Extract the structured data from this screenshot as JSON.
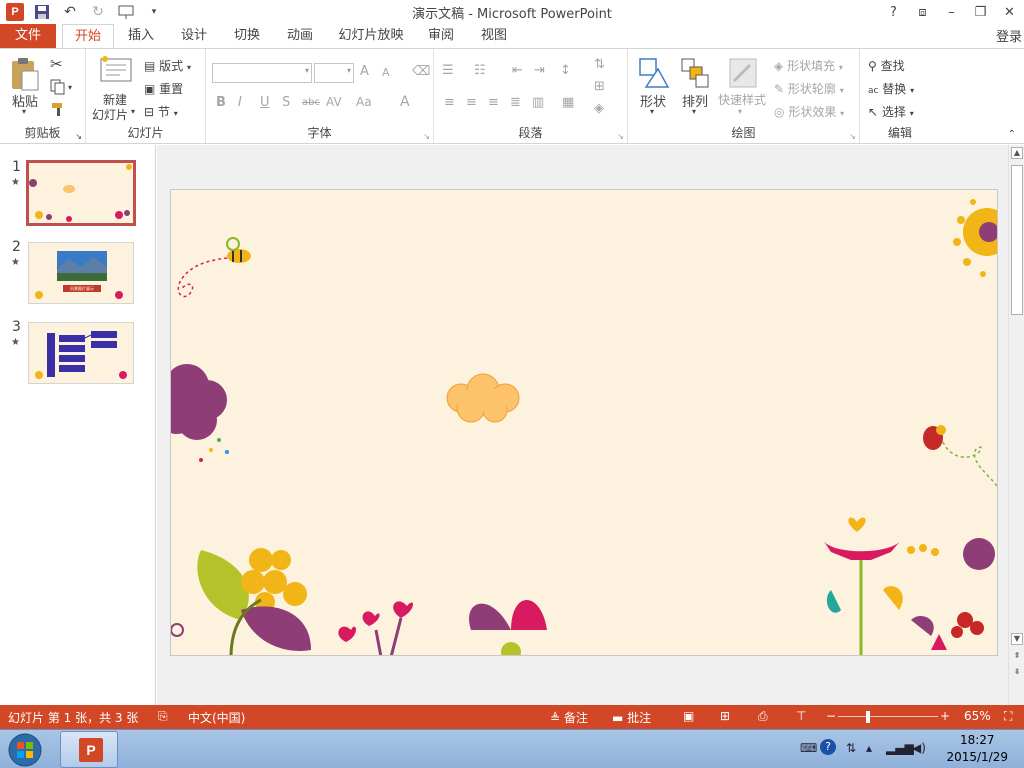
{
  "titlebar": {
    "app_badge": "P",
    "title": "演示文稿 - Microsoft PowerPoint",
    "help": "?",
    "ribbon_toggle": "⧈",
    "minimize": "–",
    "maximize": "❐",
    "close": "✕"
  },
  "tabs": {
    "file": "文件",
    "home": "开始",
    "insert": "插入",
    "design": "设计",
    "transitions": "切换",
    "animations": "动画",
    "slideshow": "幻灯片放映",
    "review": "审阅",
    "view": "视图",
    "login": "登录"
  },
  "ribbon": {
    "clipboard": {
      "paste": "粘贴",
      "label": "剪贴板"
    },
    "slides": {
      "new_slide_1": "新建",
      "new_slide_2": "幻灯片",
      "layout": "版式",
      "reset": "重置",
      "section": "节",
      "label": "幻灯片"
    },
    "font": {
      "bold": "B",
      "italic": "I",
      "underline": "U",
      "shadow": "S",
      "strike": "abc",
      "spacing": "AV",
      "case": "Aa",
      "color": "A",
      "grow": "A",
      "shrink": "A",
      "label": "字体"
    },
    "paragraph": {
      "label": "段落"
    },
    "drawing": {
      "shapes": "形状",
      "arrange": "排列",
      "quick_styles": "快速样式",
      "fill": "形状填充",
      "outline": "形状轮廓",
      "effects": "形状效果",
      "label": "绘图"
    },
    "editing": {
      "find": "查找",
      "replace": "替换",
      "select": "选择",
      "label": "编辑"
    }
  },
  "thumbnails": [
    {
      "num": "1",
      "star": "★"
    },
    {
      "num": "2",
      "star": "★",
      "caption": "风景图片展示"
    },
    {
      "num": "3",
      "star": "★"
    }
  ],
  "statusbar": {
    "slide_info": "幻灯片 第 1 张，共 3 张",
    "language": "中文(中国)",
    "notes": "备注",
    "comments": "批注",
    "zoom": "65%"
  },
  "taskbar": {
    "time": "18:27",
    "date": "2015/1/29",
    "app_badge": "P"
  },
  "colors": {
    "accent": "#d24726",
    "slide_bg": "#fdf2dd",
    "cloud": "#fcc36b",
    "magenta": "#d81b60",
    "purple": "#8e3d77",
    "yellow": "#f2b518"
  }
}
